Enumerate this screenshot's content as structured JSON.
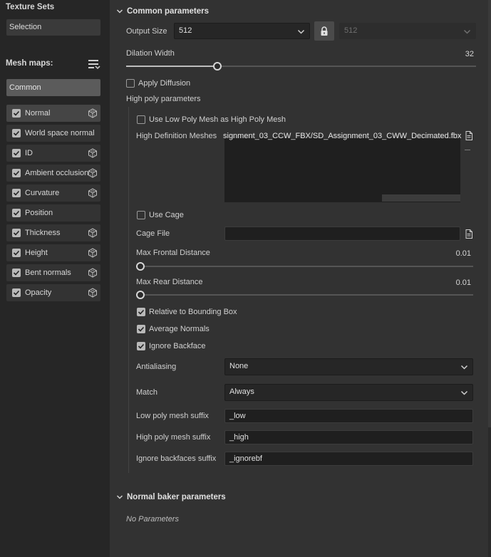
{
  "sidebar": {
    "title": "Texture Sets",
    "selection_label": "Selection",
    "mesh_maps_label": "Mesh maps:",
    "common_label": "Common",
    "items": [
      {
        "label": "Normal",
        "checked": true,
        "has_cube": true,
        "active": true
      },
      {
        "label": "World space normal",
        "checked": true,
        "has_cube": false,
        "active": false
      },
      {
        "label": "ID",
        "checked": true,
        "has_cube": true,
        "active": false
      },
      {
        "label": "Ambient occlusion",
        "checked": true,
        "has_cube": true,
        "active": false
      },
      {
        "label": "Curvature",
        "checked": true,
        "has_cube": true,
        "active": false
      },
      {
        "label": "Position",
        "checked": true,
        "has_cube": false,
        "active": false
      },
      {
        "label": "Thickness",
        "checked": true,
        "has_cube": true,
        "active": false
      },
      {
        "label": "Height",
        "checked": true,
        "has_cube": true,
        "active": false
      },
      {
        "label": "Bent normals",
        "checked": true,
        "has_cube": true,
        "active": false
      },
      {
        "label": "Opacity",
        "checked": true,
        "has_cube": true,
        "active": false
      }
    ]
  },
  "common": {
    "section_title": "Common parameters",
    "output_size_label": "Output Size",
    "output_size_value": "512",
    "output_size_linked_value": "512",
    "dilation_label": "Dilation Width",
    "dilation_value": "32",
    "dilation_fraction": 0.26,
    "apply_diffusion_label": "Apply Diffusion",
    "apply_diffusion_checked": false,
    "high_poly_title": "High poly parameters",
    "use_low_poly_label": "Use Low Poly Mesh as High Poly Mesh",
    "use_low_poly_checked": false,
    "high_def_label": "High Definition Meshes",
    "high_def_path": "signment_03_CCW_FBX/SD_Assignment_03_CWW_Decimated.fbx",
    "use_cage_label": "Use Cage",
    "use_cage_checked": false,
    "cage_file_label": "Cage File",
    "cage_file_value": "",
    "max_frontal_label": "Max Frontal Distance",
    "max_frontal_value": "0.01",
    "max_frontal_fraction": 0.01,
    "max_rear_label": "Max Rear Distance",
    "max_rear_value": "0.01",
    "max_rear_fraction": 0.01,
    "relative_bbox_label": "Relative to Bounding Box",
    "relative_bbox_checked": true,
    "average_normals_label": "Average Normals",
    "average_normals_checked": true,
    "ignore_backface_label": "Ignore Backface",
    "ignore_backface_checked": true,
    "antialiasing_label": "Antialiasing",
    "antialiasing_value": "None",
    "match_label": "Match",
    "match_value": "Always",
    "low_suffix_label": "Low poly mesh suffix",
    "low_suffix_value": "_low",
    "high_suffix_label": "High poly mesh suffix",
    "high_suffix_value": "_high",
    "ignore_suffix_label": "Ignore backfaces suffix",
    "ignore_suffix_value": "_ignorebf"
  },
  "normal_baker": {
    "section_title": "Normal baker parameters",
    "no_params": "No Parameters"
  }
}
